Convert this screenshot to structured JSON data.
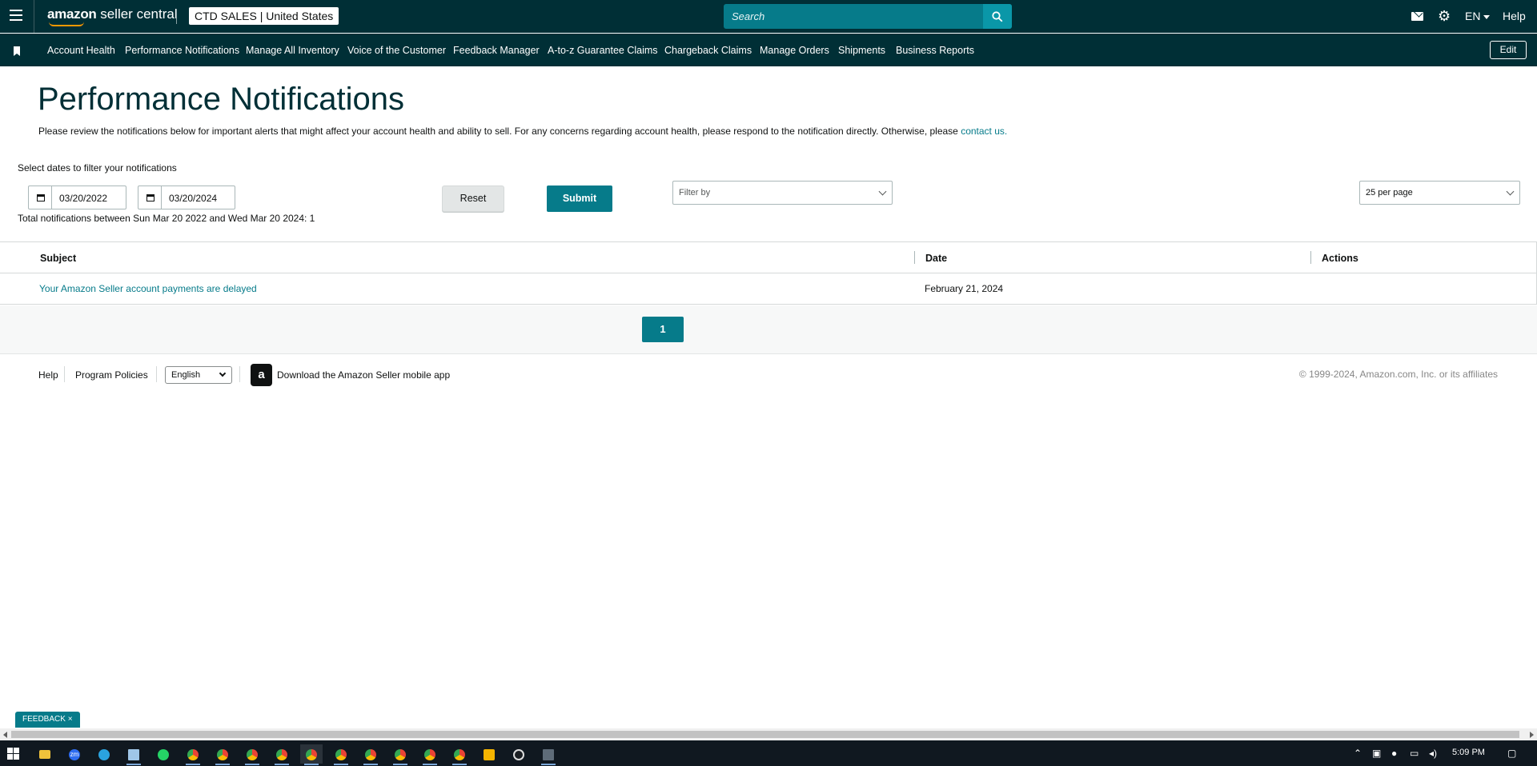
{
  "header": {
    "logo_text": "amazon",
    "logo_sub": " seller central",
    "store_name": "CTD SALES",
    "store_region": "United States",
    "search_placeholder": "Search",
    "language": "EN",
    "help": "Help"
  },
  "nav": {
    "items": [
      {
        "label": "Account Health"
      },
      {
        "label": "Performance Notifications"
      },
      {
        "label": "Manage All Inventory"
      },
      {
        "label": "Voice of the Customer"
      },
      {
        "label": "Feedback Manager"
      },
      {
        "label": "A-to-z Guarantee Claims"
      },
      {
        "label": "Chargeback Claims"
      },
      {
        "label": "Manage Orders"
      },
      {
        "label": "Shipments"
      },
      {
        "label": "Business Reports"
      }
    ],
    "edit": "Edit"
  },
  "page": {
    "title": "Performance Notifications",
    "intro": "Please review the notifications below for important alerts that might affect your account health and ability to sell. For any concerns regarding account health, please respond to the notification directly. Otherwise, please ",
    "intro_link": "contact us."
  },
  "filters": {
    "label": "Select dates to filter your notifications",
    "start_date": "03/20/2022",
    "end_date": "03/20/2024",
    "reset": "Reset",
    "submit": "Submit",
    "filter_by_placeholder": "Filter by",
    "per_page": "25 per page",
    "total": "Total notifications between Sun Mar 20 2022 and Wed Mar 20 2024: 1"
  },
  "table": {
    "headers": [
      "Subject",
      "Date",
      "Actions"
    ],
    "rows": [
      {
        "subject": "Your Amazon Seller account payments are delayed",
        "date": "February 21, 2024",
        "actions": ""
      }
    ]
  },
  "pagination": {
    "current": "1"
  },
  "footer": {
    "help": "Help",
    "policies": "Program Policies",
    "language": "English",
    "app_icon_letter": "a",
    "app_link": "Download the Amazon Seller mobile app",
    "copyright": "© 1999-2024, Amazon.com, Inc. or its affiliates"
  },
  "feedback": {
    "label": "FEEDBACK",
    "close": "×"
  },
  "taskbar": {
    "time": "5:09 PM",
    "apps": [
      "file-explorer",
      "zoom",
      "telegram",
      "notepad",
      "whatsapp",
      "chrome",
      "chrome",
      "chrome",
      "chrome",
      "chrome",
      "chrome",
      "chrome",
      "chrome",
      "chrome",
      "chrome",
      "rocket-app",
      "github",
      "calculator"
    ],
    "zoom_label": "zm",
    "accent": "#067b8a"
  }
}
